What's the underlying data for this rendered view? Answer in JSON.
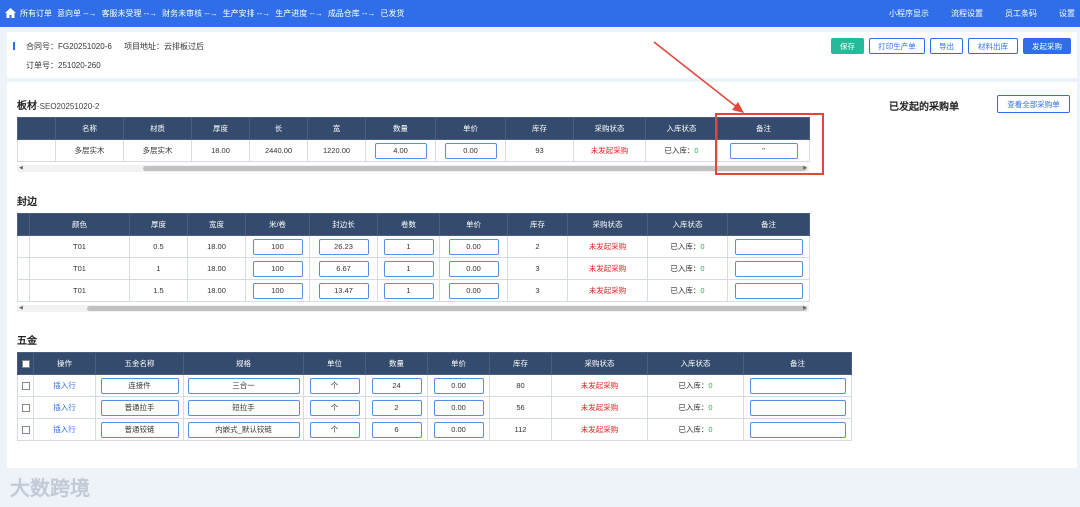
{
  "topbar": {
    "crumbs": [
      "所有订单",
      "意向单 --→",
      "客服未受理 --→",
      "财务未审核 --→",
      "生产安排 --→",
      "生产进度 --→",
      "成品仓库 --→",
      "已发货"
    ],
    "right": [
      "小程序显示",
      "流程设置",
      "员工条码",
      "设置"
    ]
  },
  "header": {
    "contract": "合同号：FG20251020-6",
    "project": "项目地址：云排板过后",
    "order": "订单号：251020-260"
  },
  "buttons": {
    "save": "保存",
    "print": "打印生产单",
    "export": "导出",
    "material": "材料出库",
    "purchase": "发起采购"
  },
  "board": {
    "title": "板材",
    "code": "-SEO20251020-2",
    "headers": [
      "名称",
      "材质",
      "厚度",
      "长",
      "宽",
      "数量",
      "单价",
      "库存",
      "采购状态",
      "入库状态",
      "备注"
    ],
    "rows": [
      {
        "name": "多层实木",
        "material": "多层实木",
        "thick": "18.00",
        "len": "2440.00",
        "wid": "1220.00",
        "qty": "4.00",
        "price": "0.00",
        "stock": "93",
        "pstatus": "未发起采购",
        "instock_label": "已入库：",
        "instock_val": "0",
        "note": "''"
      }
    ]
  },
  "edge": {
    "title": "封边",
    "headers": [
      "颜色",
      "厚度",
      "宽度",
      "米/卷",
      "封边长",
      "卷数",
      "单价",
      "库存",
      "采购状态",
      "入库状态",
      "备注"
    ],
    "rows": [
      {
        "color": "T01",
        "thick": "0.5",
        "width": "18.00",
        "mpr": "100",
        "len": "26.23",
        "rolls": "1",
        "price": "0.00",
        "stock": "2",
        "pstatus": "未发起采购",
        "instock_label": "已入库：",
        "instock_val": "0"
      },
      {
        "color": "T01",
        "thick": "1",
        "width": "18.00",
        "mpr": "100",
        "len": "6.67",
        "rolls": "1",
        "price": "0.00",
        "stock": "3",
        "pstatus": "未发起采购",
        "instock_label": "已入库：",
        "instock_val": "0"
      },
      {
        "color": "T01",
        "thick": "1.5",
        "width": "18.00",
        "mpr": "100",
        "len": "13.47",
        "rolls": "1",
        "price": "0.00",
        "stock": "3",
        "pstatus": "未发起采购",
        "instock_label": "已入库：",
        "instock_val": "0"
      }
    ]
  },
  "hardware": {
    "title": "五金",
    "headers": [
      "操作",
      "五金名称",
      "规格",
      "单位",
      "数量",
      "单价",
      "库存",
      "采购状态",
      "入库状态",
      "备注"
    ],
    "rows": [
      {
        "op": "插入行",
        "name": "连接件",
        "spec": "三合一",
        "unit": "个",
        "qty": "24",
        "price": "0.00",
        "stock": "80",
        "pstatus": "未发起采购",
        "instock_label": "已入库：",
        "instock_val": "0"
      },
      {
        "op": "插入行",
        "name": "普通拉手",
        "spec": "短拉手",
        "unit": "个",
        "qty": "2",
        "price": "0.00",
        "stock": "56",
        "pstatus": "未发起采购",
        "instock_label": "已入库：",
        "instock_val": "0"
      },
      {
        "op": "插入行",
        "name": "普通铰链",
        "spec": "内嵌式_默认铰链",
        "unit": "个",
        "qty": "6",
        "price": "0.00",
        "stock": "112",
        "pstatus": "未发起采购",
        "instock_label": "已入库：",
        "instock_val": "0"
      }
    ]
  },
  "purchase_panel": {
    "title": "已发起的采购单",
    "view_all": "查看全部采购单"
  },
  "watermark": "大数跨境",
  "colors": {
    "accent": "#2f6ee8",
    "header_bg": "#344b6e",
    "save": "#26b99a",
    "status_red": "#e02020",
    "status_green": "#2ab04a",
    "annotation": "#e0463a"
  }
}
